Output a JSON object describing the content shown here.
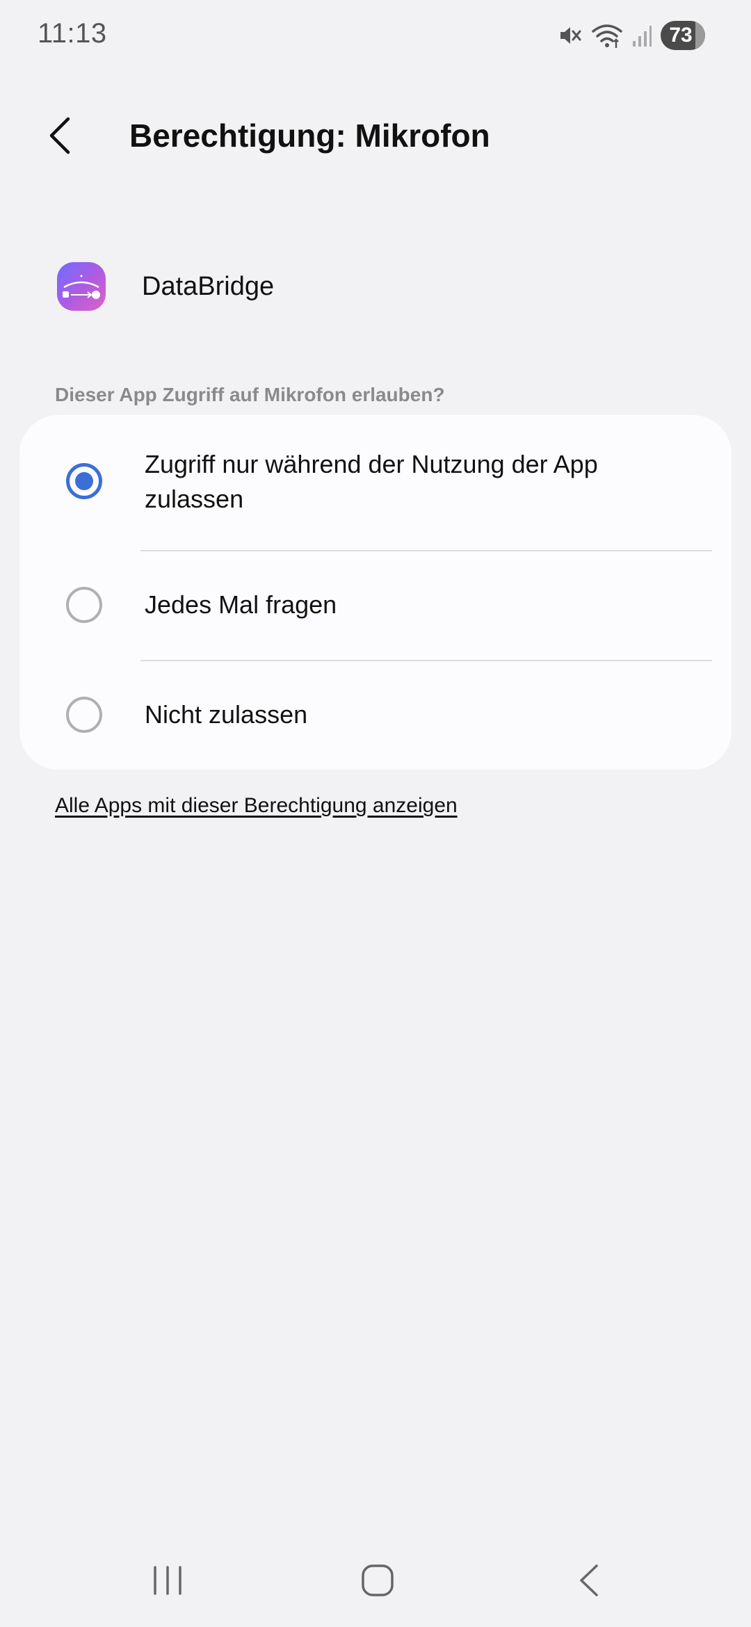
{
  "status_bar": {
    "time": "11:13",
    "battery": "73",
    "icons": [
      "mute-icon",
      "wifi-icon",
      "signal-icon",
      "battery-icon"
    ]
  },
  "header": {
    "title": "Berechtigung: Mikrofon",
    "back_icon": "chevron-left-icon"
  },
  "app": {
    "name": "DataBridge"
  },
  "permission": {
    "question": "Dieser App Zugriff auf Mikrofon erlauben?",
    "options": [
      {
        "label": "Zugriff nur während der Nutzung der App zulassen",
        "selected": true
      },
      {
        "label": "Jedes Mal fragen",
        "selected": false
      },
      {
        "label": "Nicht zulassen",
        "selected": false
      }
    ]
  },
  "link": {
    "label": "Alle Apps mit dieser Berechtigung anzeigen"
  },
  "colors": {
    "accent": "#3b6ed7",
    "background": "#f2f2f4",
    "card": "#fcfcfe"
  },
  "nav_bar": {
    "icons": [
      "recent-apps-icon",
      "home-icon",
      "back-icon"
    ]
  }
}
